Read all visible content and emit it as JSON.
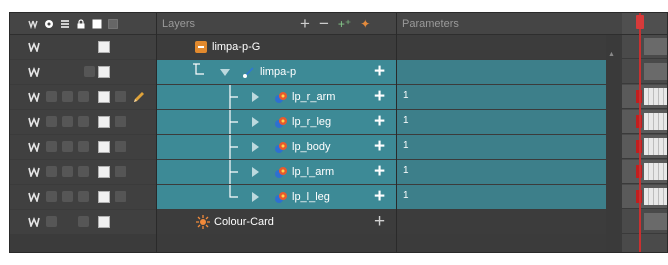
{
  "header": {
    "layers_label": "Layers",
    "parameters_label": "Parameters",
    "tool_add": "+",
    "tool_remove": "−",
    "tool_add_peg": "⁺",
    "tool_effect": "✦"
  },
  "icons": {
    "eye": "eye-icon",
    "sound": "sound-icon",
    "lock": "lock-icon",
    "swatch": "color-swatch-icon",
    "thumbnail": "thumbnail-icon"
  },
  "colors": {
    "selected_row": "#3d8a96",
    "group_icon": "#e28a2e",
    "keyframe": "#c21e1e",
    "panel_bg": "#3b3b3b"
  },
  "layers": [
    {
      "name": "limpa-p-G",
      "type": "group",
      "param": ""
    },
    {
      "name": "limpa-p",
      "type": "peg",
      "param": ""
    },
    {
      "name": "lp_r_arm",
      "type": "drawing",
      "param": "1"
    },
    {
      "name": "lp_r_leg",
      "type": "drawing",
      "param": "1"
    },
    {
      "name": "lp_body",
      "type": "drawing",
      "param": "1"
    },
    {
      "name": "lp_l_arm",
      "type": "drawing",
      "param": "1"
    },
    {
      "name": "lp_l_leg",
      "type": "drawing",
      "param": "1"
    },
    {
      "name": "Colour-Card",
      "type": "colour-card",
      "param": ""
    }
  ]
}
